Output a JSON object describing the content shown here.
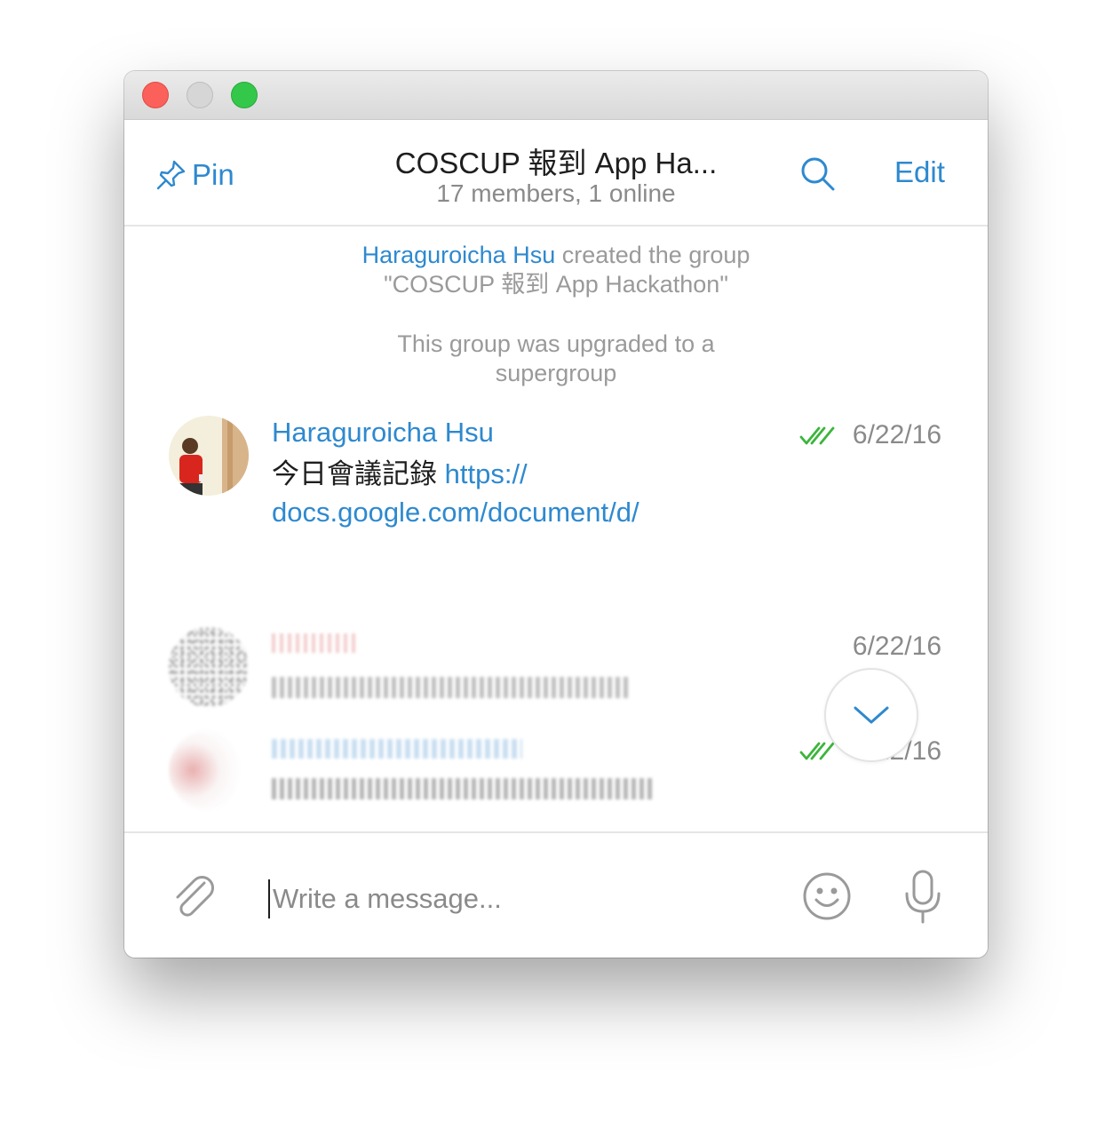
{
  "header": {
    "pin_label": "Pin",
    "title": "COSCUP 報到 App Ha...",
    "subtitle": "17 members, 1 online",
    "edit_label": "Edit"
  },
  "service_messages": {
    "created_user": "Haraguroicha Hsu",
    "created_text": "created the group",
    "created_group_name": "\"COSCUP 報到 App Hackathon\"",
    "upgraded_line1": "This group was upgraded to a",
    "upgraded_line2": "supergroup"
  },
  "messages": [
    {
      "author": "Haraguroicha Hsu",
      "text": "今日會議記錄",
      "url_line1": "https://",
      "url_line2": "docs.google.com/document/d/",
      "date": "6/22/16",
      "read": true
    },
    {
      "date": "6/22/16",
      "read": false
    },
    {
      "date": "6/22/16",
      "read": true
    }
  ],
  "composer": {
    "placeholder": "Write a message..."
  },
  "colors": {
    "accent": "#2e89cf",
    "read_check": "#3cb53c",
    "muted_text": "#8a8a8a"
  },
  "icons": {
    "pin": "pin-icon",
    "search": "search-icon",
    "scroll_down": "chevron-down-icon",
    "attach": "paperclip-icon",
    "emoji": "smiley-icon",
    "mic": "microphone-icon",
    "read": "double-check-icon"
  }
}
